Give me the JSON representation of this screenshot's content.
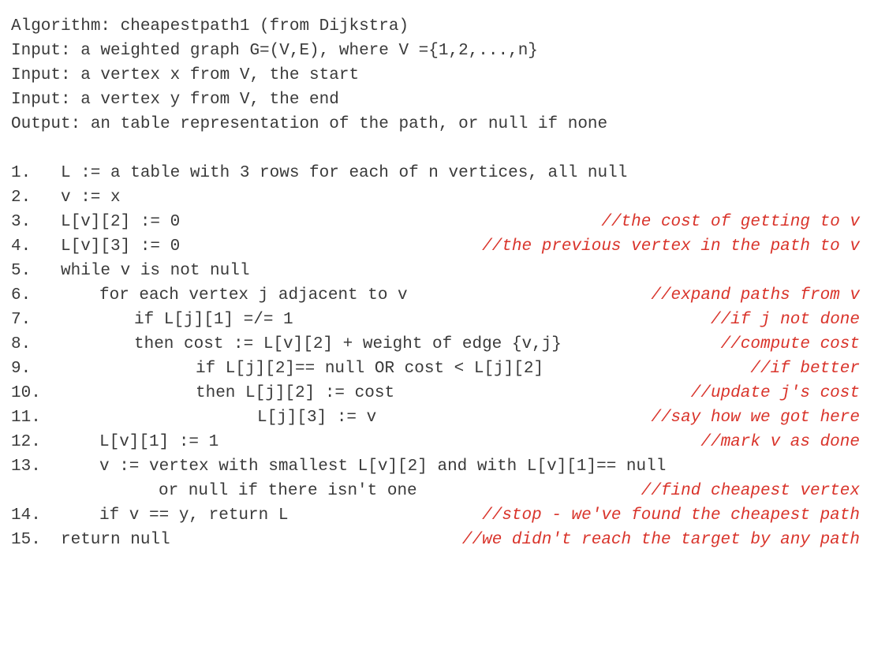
{
  "header": [
    "Algorithm: cheapestpath1 (from Dijkstra)",
    "Input: a weighted graph G=(V,E), where V ={1,2,...,n}",
    "Input: a vertex x from V, the start",
    "Input: a vertex y from V, the end",
    "Output: an table representation of the path, or null if none"
  ],
  "steps": [
    {
      "num": "1.",
      "code": "L := a table with 3 rows for each of n vertices, all null",
      "comment": ""
    },
    {
      "num": "2.",
      "code": "v := x",
      "comment": ""
    },
    {
      "num": "3.",
      "code": "L[v][2] := 0",
      "comment": "//the cost of getting to v"
    },
    {
      "num": "4.",
      "code": "L[v][3] := 0",
      "comment": "//the previous vertex in the path to v"
    },
    {
      "num": "5.",
      "code": "while v is not null",
      "comment": ""
    },
    {
      "num": "6.",
      "code": "for each vertex j adjacent to v",
      "comment": "//expand paths from v"
    },
    {
      "num": "7.",
      "code": "if L[j][1] =/= 1",
      "comment": "//if j not done"
    },
    {
      "num": "8.",
      "code": "then cost := L[v][2] + weight of edge {v,j}",
      "comment": "//compute cost"
    },
    {
      "num": "9.",
      "code": "if L[j][2]== null OR cost < L[j][2]",
      "comment": "//if better"
    },
    {
      "num": "10.",
      "code": "then L[j][2] := cost",
      "comment": "//update j's cost"
    },
    {
      "num": "11.",
      "code": "L[j][3] := v",
      "comment": "//say how we got here"
    },
    {
      "num": "12.",
      "code": "L[v][1] := 1",
      "comment": "//mark v as done"
    },
    {
      "num": "13.",
      "code": "v := vertex with smallest L[v][2] and with L[v][1]== null",
      "comment": ""
    },
    {
      "num": "",
      "code": "or null if there isn't one",
      "comment": "//find cheapest vertex"
    },
    {
      "num": "14.",
      "code": "if v == y, return L",
      "comment": "//stop - we've found the cheapest path"
    },
    {
      "num": "15.",
      "code": "return null",
      "comment": "//we didn't reach the target by any path"
    }
  ]
}
